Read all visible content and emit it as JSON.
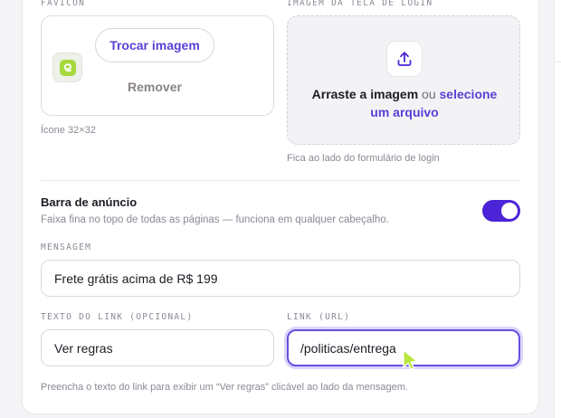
{
  "favicon": {
    "label": "FAVICON",
    "change_button": "Trocar imagem",
    "remove_button": "Remover",
    "hint": "Ícone 32×32"
  },
  "login_image": {
    "label": "IMAGEM DA TELA DE LOGIN",
    "drop_main": "Arraste a imagem",
    "drop_or": "ou",
    "drop_link_1": "selecione",
    "drop_link_2": "um arquivo",
    "hint": "Fica ao lado do formulário de login"
  },
  "banner": {
    "title": "Barra de anúncio",
    "subtitle": "Faixa fina no topo de todas as páginas — funciona em qualquer cabeçalho.",
    "enabled": true,
    "message_label": "MENSAGEM",
    "message_value": "Frete grátis acima de R$ 199",
    "link_text_label": "TEXTO DO LINK (OPCIONAL)",
    "link_text_value": "Ver regras",
    "link_url_label": "LINK (URL)",
    "link_url_value": "/politicas/entrega",
    "footer_hint": "Preencha o texto do link para exibir um “Ver regras” clicável ao lado da mensagem."
  },
  "colors": {
    "accent": "#5b3fd6",
    "toggle_on": "#4a24d6",
    "cursor": "#b8e63a"
  }
}
